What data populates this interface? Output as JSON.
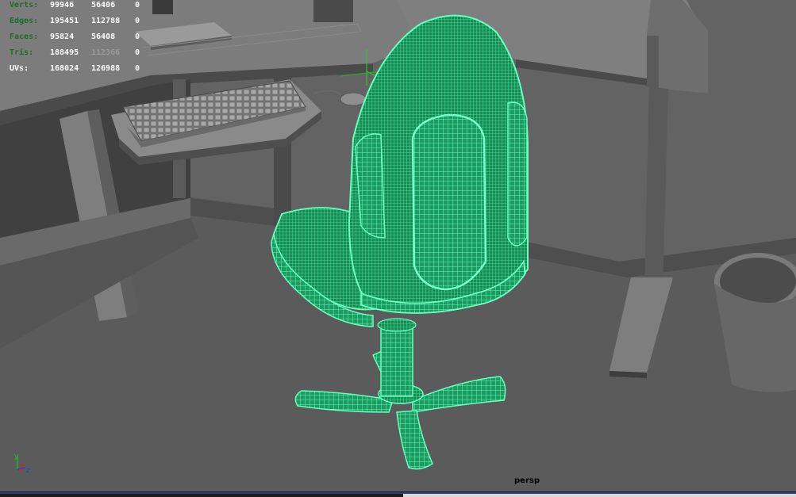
{
  "viewport": {
    "camera": "persp"
  },
  "heads_up_display": {
    "rows": [
      {
        "label": "Verts:",
        "total": "99946",
        "selected": "56406",
        "components": "0",
        "label_color": "#1a6e2a",
        "selected_ghosted": false
      },
      {
        "label": "Edges:",
        "total": "195451",
        "selected": "112788",
        "components": "0",
        "label_color": "#1a6e2a",
        "selected_ghosted": false
      },
      {
        "label": "Faces:",
        "total": "95824",
        "selected": "56408",
        "components": "0",
        "label_color": "#1a6e2a",
        "selected_ghosted": false
      },
      {
        "label": "Tris:",
        "total": "188495",
        "selected": "112366",
        "components": "0",
        "label_color": "#1a6e2a",
        "selected_ghosted": true
      },
      {
        "label": "UVs:",
        "total": "168024",
        "selected": "126988",
        "components": "0",
        "label_color": "#ffffff",
        "selected_ghosted": false
      }
    ]
  },
  "axis_gizmo": {
    "y_label": "y",
    "x_label": "x",
    "z_label": "z"
  },
  "colors": {
    "background": "#5a5a5a",
    "wireframe_selected": "#3ce89a",
    "wireframe_fill": "#1f9a64",
    "axis_x": "#e02020",
    "axis_y": "#20c020",
    "axis_z": "#2040e0"
  }
}
